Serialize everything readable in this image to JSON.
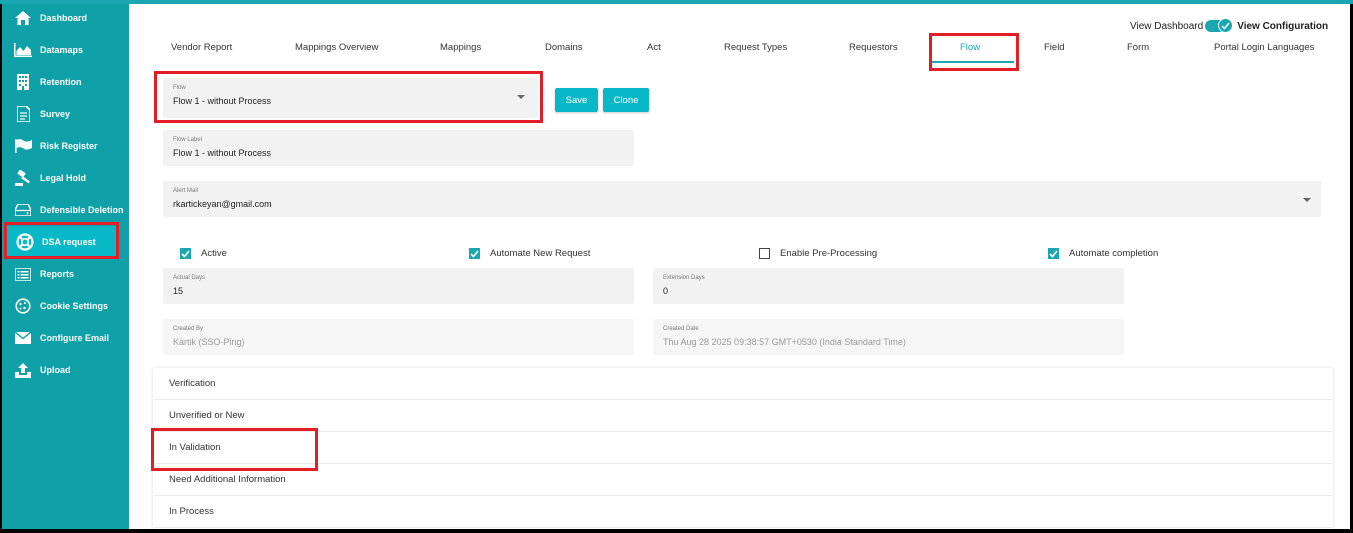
{
  "sidebar": {
    "items": [
      {
        "label": "Dashboard",
        "icon": "home-icon"
      },
      {
        "label": "Datamaps",
        "icon": "area-chart-icon"
      },
      {
        "label": "Retention",
        "icon": "building-icon"
      },
      {
        "label": "Survey",
        "icon": "document-icon"
      },
      {
        "label": "Risk Register",
        "icon": "flag-icon"
      },
      {
        "label": "Legal Hold",
        "icon": "gavel-icon"
      },
      {
        "label": "Defensible Deletion",
        "icon": "drive-icon"
      },
      {
        "label": "DSA request",
        "icon": "lifebuoy-icon"
      },
      {
        "label": "Reports",
        "icon": "list-icon"
      },
      {
        "label": "Cookie Settings",
        "icon": "cookie-icon"
      },
      {
        "label": "Configure Email",
        "icon": "mail-icon"
      },
      {
        "label": "Upload",
        "icon": "upload-icon"
      }
    ],
    "active_index": 7,
    "bg_color": "#10a0a8",
    "active_color": "#09b8c6"
  },
  "view_toggle": {
    "left_label": "View Dashboard",
    "right_label": "View Configuration"
  },
  "tabs": [
    {
      "label": "Vendor Report"
    },
    {
      "label": "Mappings Overview"
    },
    {
      "label": "Mappings"
    },
    {
      "label": "Domains"
    },
    {
      "label": "Act"
    },
    {
      "label": "Request Types"
    },
    {
      "label": "Requestors"
    },
    {
      "label": "Flow"
    },
    {
      "label": "Field"
    },
    {
      "label": "Form"
    },
    {
      "label": "Portal Login Languages"
    }
  ],
  "active_tab": "Flow",
  "flow_select": {
    "label": "Flow",
    "value": "Flow 1 - without Process"
  },
  "buttons": {
    "save": "Save",
    "clone": "Clone"
  },
  "flow_label": {
    "label": "Flow Label",
    "value": "Flow 1 - without Process"
  },
  "alert_mail": {
    "label": "Alert Mail",
    "value": "rkartickeyan@gmail.com"
  },
  "checkboxes": [
    {
      "label": "Active",
      "checked": true
    },
    {
      "label": "Automate New Request",
      "checked": true
    },
    {
      "label": "Enable Pre-Processing",
      "checked": false
    },
    {
      "label": "Automate completion",
      "checked": true
    }
  ],
  "actual_days": {
    "label": "Actual Days",
    "value": "15"
  },
  "extension_days": {
    "label": "Extension Days",
    "value": "0"
  },
  "created_by": {
    "label": "Created By",
    "value": "Kartik (SSO-Ping)"
  },
  "created_date": {
    "label": "Created Date",
    "value": "Thu Aug 28 2025 09:38:57 GMT+0530 (India Standard Time)"
  },
  "stages": [
    {
      "label": "Verification"
    },
    {
      "label": "Unverified or New"
    },
    {
      "label": "In Validation"
    },
    {
      "label": "Need Additional Information"
    },
    {
      "label": "In Process"
    }
  ],
  "colors": {
    "accent": "#1aa7b2",
    "highlight": "#e21f26"
  }
}
